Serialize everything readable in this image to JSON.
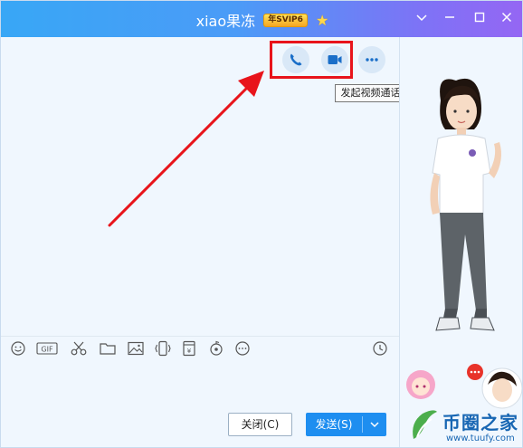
{
  "window": {
    "title": "xiao果冻",
    "vip_badge": "年SVIP6",
    "controls": {
      "menu": "chevron-down-icon",
      "minimize": "minimize-icon",
      "maximize": "maximize-icon",
      "close": "close-icon"
    }
  },
  "call_buttons": {
    "voice": "phone-icon",
    "video": "video-camera-icon",
    "more": "more-icon"
  },
  "tooltip": "发起视频通话",
  "toolbar": [
    "emoji-icon",
    "gif-icon",
    "screenshot-scissors-icon",
    "folder-icon",
    "image-icon",
    "shake-icon",
    "red-packet-icon",
    "music-icon",
    "more-icon",
    "history-clock-icon"
  ],
  "buttons": {
    "close_label": "关闭(C)",
    "send_label": "发送(S)",
    "send_dropdown": "▾"
  },
  "watermark": {
    "text": "币圈之家",
    "url": "www.tuufy.com"
  },
  "colors": {
    "titlebar_start": "#38a7f6",
    "titlebar_end": "#9566f4",
    "send_button": "#1e8ef0",
    "highlight": "#e8141b"
  }
}
